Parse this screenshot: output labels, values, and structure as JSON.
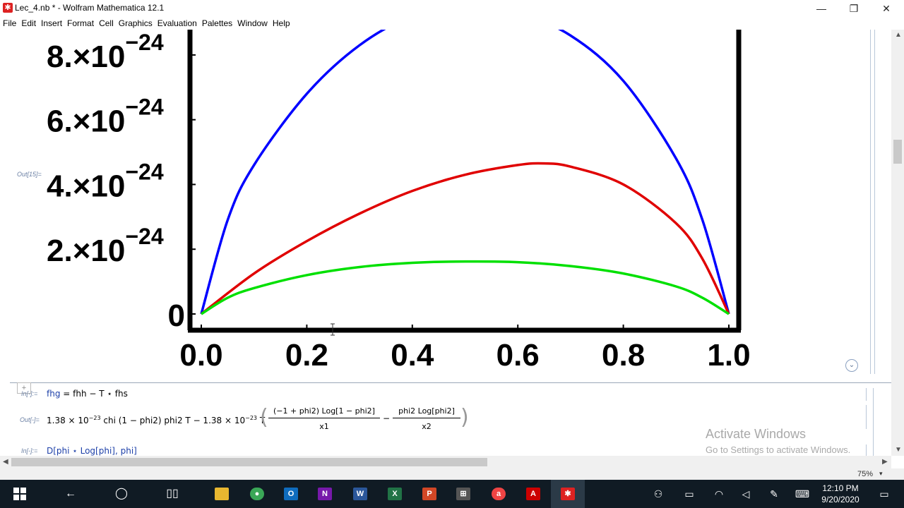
{
  "window": {
    "title": "Lec_4.nb * - Wolfram Mathematica 12.1",
    "minimize": "—",
    "maximize": "❐",
    "close": "✕"
  },
  "menu": [
    "File",
    "Edit",
    "Insert",
    "Format",
    "Cell",
    "Graphics",
    "Evaluation",
    "Palettes",
    "Window",
    "Help"
  ],
  "notebook": {
    "out_label_plot": "Out[15]=",
    "in_label_1": "In[-]:=",
    "out_label_2": "Out[-]=",
    "in_label_3": "In[-]:=",
    "input_1": {
      "a": "fhg",
      "b": " = ",
      "c": "fhh",
      "d": " − T ⋆ fhs"
    },
    "output_2": {
      "prefix": "1.38 × 10",
      "exp1": "−23",
      "mid": " chi (1 − phi2) phi2 T − 1.38 × 10",
      "exp2": "−23",
      "t": " T",
      "num1": "(−1 + phi2) Log[1 − phi2]",
      "den1": "x1",
      "minus": "−",
      "num2": "phi2 Log[phi2]",
      "den2": "x2"
    },
    "input_3": "D[phi ⋆ Log[phi], phi]",
    "add_cell": "+"
  },
  "chart_data": {
    "type": "line",
    "x_ticks": [
      "0.0",
      "0.2",
      "0.4",
      "0.6",
      "0.8",
      "1.0"
    ],
    "y_ticks": [
      {
        "label": "0",
        "value": 0
      },
      {
        "mant": "2.",
        "exp": "−24",
        "value": 2e-24
      },
      {
        "mant": "4.",
        "exp": "−24",
        "value": 4e-24
      },
      {
        "mant": "6.",
        "exp": "−24",
        "value": 6e-24
      },
      {
        "mant": "8.",
        "exp": "−24",
        "value": 8e-24
      }
    ],
    "xlim": [
      0,
      1
    ],
    "ylim": [
      0,
      9e-24
    ],
    "series": [
      {
        "color": "#0000ff",
        "x": [
          0.0,
          0.05,
          0.1,
          0.2,
          0.3,
          0.4,
          0.5,
          0.6,
          0.7,
          0.8,
          0.9,
          0.95,
          1.0
        ],
        "y": [
          0,
          2.9e-24,
          4.6e-24,
          6.8e-24,
          8.3e-24,
          9.2e-24,
          9.5e-24,
          9.3e-24,
          8.6e-24,
          7.2e-24,
          4.8e-24,
          2.9e-24,
          0
        ]
      },
      {
        "color": "#e00000",
        "x": [
          0.0,
          0.1,
          0.2,
          0.3,
          0.4,
          0.5,
          0.6,
          0.65,
          0.7,
          0.8,
          0.9,
          0.95,
          1.0
        ],
        "y": [
          0,
          1.25e-24,
          2.25e-24,
          3.1e-24,
          3.8e-24,
          4.3e-24,
          4.6e-24,
          4.65e-24,
          4.55e-24,
          4e-24,
          2.8e-24,
          1.7e-24,
          0
        ]
      },
      {
        "color": "#00e000",
        "x": [
          0.0,
          0.05,
          0.1,
          0.2,
          0.3,
          0.4,
          0.5,
          0.6,
          0.7,
          0.8,
          0.9,
          0.95,
          1.0
        ],
        "y": [
          0,
          5e-25,
          8e-25,
          1.2e-24,
          1.45e-24,
          1.58e-24,
          1.62e-24,
          1.6e-24,
          1.48e-24,
          1.25e-24,
          8.5e-25,
          5e-25,
          0
        ]
      }
    ],
    "grid": false
  },
  "statusbar": {
    "zoom": "75%"
  },
  "watermark": {
    "line1": "Activate Windows",
    "line2": "Go to Settings to activate Windows."
  },
  "taskbar": {
    "time": "12:10 PM",
    "date": "9/20/2020",
    "apps": [
      "windows-start",
      "back",
      "search",
      "task-view",
      "file-explorer",
      "chrome",
      "outlook",
      "onenote",
      "word",
      "excel",
      "powerpoint",
      "store",
      "app",
      "acrobat",
      "mathematica"
    ]
  }
}
